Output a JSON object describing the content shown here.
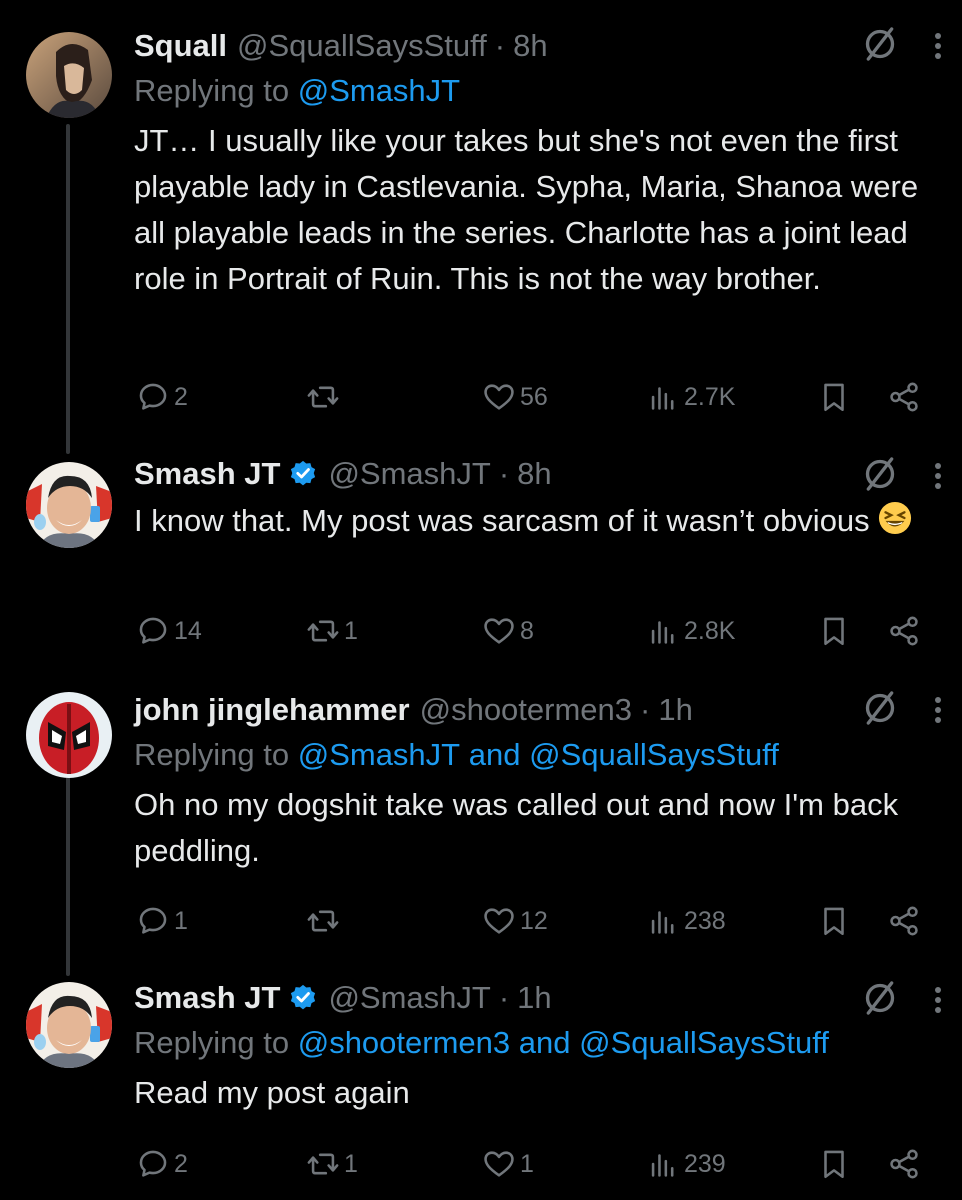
{
  "tweets": [
    {
      "name": "Squall",
      "verified": false,
      "handle": "@SquallSaysStuff",
      "dot": "·",
      "time": "8h",
      "replying_prefix": "Replying to",
      "replying_to": [
        "@SmashJT"
      ],
      "replying_and": "",
      "text": "JT… I usually like your takes but she's not even the first playable lady in Castlevania. Sypha, Maria, Shanoa were all playable leads in the series. Charlotte has a joint lead role in Portrait of Ruin. This is not the way brother.",
      "replies": "2",
      "reposts": "",
      "likes": "56",
      "views": "2.7K"
    },
    {
      "name": "Smash JT",
      "verified": true,
      "handle": "@SmashJT",
      "dot": "·",
      "time": "8h",
      "replying_prefix": "",
      "replying_to": [],
      "text": "I know that. My post was sarcasm of it wasn’t obvious",
      "emoji": "grinning-squinting-face",
      "replies": "14",
      "reposts": "1",
      "likes": "8",
      "views": "2.8K"
    },
    {
      "name": "john jinglehammer",
      "verified": false,
      "handle": "@shootermen3",
      "dot": "·",
      "time": "1h",
      "replying_prefix": "Replying to",
      "replying_to": [
        "@SmashJT",
        "@SquallSaysStuff"
      ],
      "replying_and": "and",
      "text": "Oh no my dogshit take was called out and now I'm back peddling.",
      "replies": "1",
      "reposts": "",
      "likes": "12",
      "views": "238"
    },
    {
      "name": "Smash JT",
      "verified": true,
      "handle": "@SmashJT",
      "dot": "·",
      "time": "1h",
      "replying_prefix": "Replying to",
      "replying_to": [
        "@shootermen3",
        "@SquallSaysStuff"
      ],
      "replying_and": "and",
      "text": "Read my post again",
      "replies": "2",
      "reposts": "1",
      "likes": "1",
      "views": "239"
    }
  ],
  "colors": {
    "background": "#000000",
    "text": "#e7e9ea",
    "muted": "#71767b",
    "accent": "#1d9bf0",
    "thread_line": "#333639"
  },
  "icons": [
    "reply-icon",
    "repost-icon",
    "like-icon",
    "views-icon",
    "bookmark-icon",
    "share-icon",
    "mute-icon",
    "more-icon",
    "verified-icon"
  ]
}
